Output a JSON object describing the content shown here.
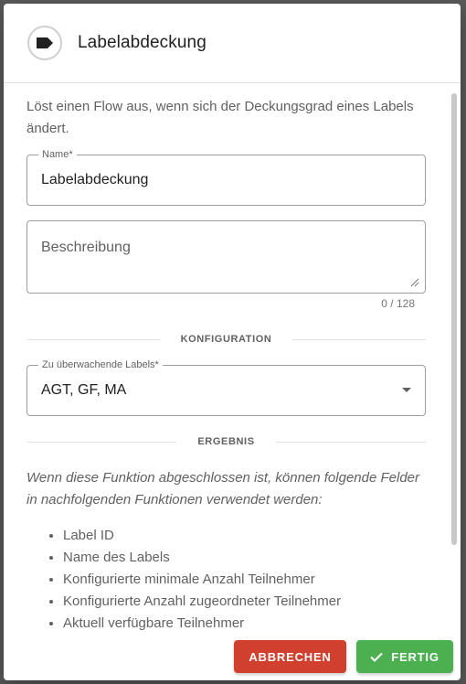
{
  "dialog": {
    "title": "Labelabdeckung",
    "icon": "label-icon"
  },
  "intro": "Löst einen Flow aus, wenn sich der Deckungsgrad eines Labels ändert.",
  "name_field": {
    "label": "Name*",
    "value": "Labelabdeckung"
  },
  "description_field": {
    "placeholder": "Beschreibung",
    "value": "",
    "counter": "0 / 128"
  },
  "sections": {
    "configuration": "KONFIGURATION",
    "result": "ERGEBNIS"
  },
  "labels_select": {
    "label": "Zu überwachende Labels*",
    "value": "AGT, GF, MA"
  },
  "result": {
    "description": "Wenn diese Funktion abgeschlossen ist, können folgende Felder in nachfolgenden Funktionen verwendet werden:",
    "fields": [
      "Label ID",
      "Name des Labels",
      "Konfigurierte minimale Anzahl Teilnehmer",
      "Konfigurierte Anzahl zugeordneter Teilnehmer",
      "Aktuell verfügbare Teilnehmer"
    ]
  },
  "footer": {
    "cancel_label": "ABBRECHEN",
    "done_label": "FERTIG"
  },
  "colors": {
    "cancel": "#d1402e",
    "done": "#4caf50"
  }
}
